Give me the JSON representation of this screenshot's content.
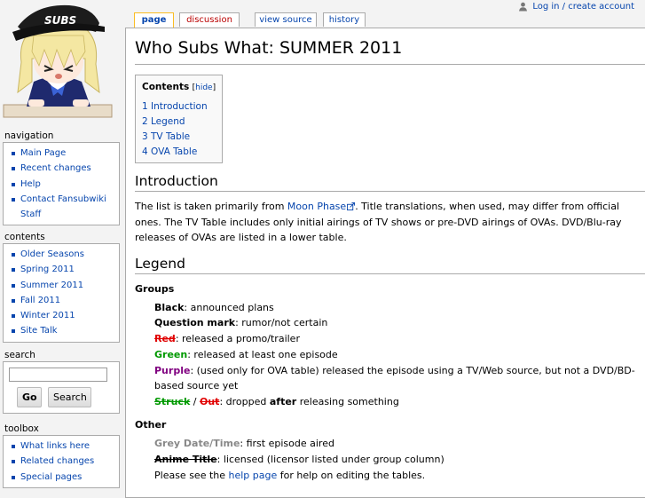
{
  "personal": {
    "login_label": "Log in / create account"
  },
  "tabs": [
    {
      "label": "page",
      "selected": true
    },
    {
      "label": "discussion",
      "new": true
    },
    {
      "label": "view source"
    },
    {
      "label": "history"
    }
  ],
  "logo": {
    "cap_text": "SUBS"
  },
  "page": {
    "title": "Who Subs What: SUMMER 2011",
    "toc": {
      "title": "Contents",
      "toggle": "hide",
      "items": [
        "1 Introduction",
        "2 Legend",
        "3 TV Table",
        "4 OVA Table"
      ]
    },
    "intro": {
      "heading": "Introduction",
      "before_link": "The list is taken primarily from ",
      "link": "Moon Phase",
      "after_link": ". Title translations, when used, may differ from official ones. The TV Table includes only initial airings of TV shows or pre-DVD airings of OVAs. DVD/Blu-ray releases of OVAs are listed in a lower table."
    },
    "legend": {
      "heading": "Legend",
      "groups_heading": "Groups",
      "black_term": "Black",
      "black_desc": ": announced plans",
      "question_term": "Question mark",
      "question_desc": ": rumor/not certain",
      "red_term": "Red",
      "red_desc": ": released a promo/trailer",
      "green_term": "Green",
      "green_desc": ": released at least one episode",
      "purple_term": "Purple",
      "purple_desc": ": (used only for OVA table) released the episode using a TV/Web source, but not a DVD/BD-based source yet",
      "struck_term": "Struck",
      "slash": " / ",
      "out_term": "Out",
      "dropped_pre": ": dropped ",
      "dropped_bold": "after",
      "dropped_post": " releasing something",
      "other_heading": "Other",
      "grey_term": "Grey Date/Time",
      "grey_desc": ": first episode aired",
      "anime_term": "Anime Title",
      "anime_desc": ": licensed (licensor listed under group column)",
      "help_pre": "Please see the ",
      "help_link": "help page",
      "help_post": " for help on editing the tables."
    }
  },
  "sidebar": {
    "navigation": {
      "title": "navigation",
      "items": [
        "Main Page",
        "Recent changes",
        "Help",
        "Contact Fansubwiki Staff"
      ]
    },
    "contents": {
      "title": "contents",
      "items": [
        "Older Seasons",
        "Spring 2011",
        "Summer 2011",
        "Fall 2011",
        "Winter 2011",
        "Site Talk"
      ]
    },
    "search": {
      "title": "search",
      "go_label": "Go",
      "search_label": "Search"
    },
    "toolbox": {
      "title": "toolbox",
      "items": [
        "What links here",
        "Related changes",
        "Special pages"
      ]
    }
  },
  "colors": {
    "link": "#0645ad",
    "red": "#e00000",
    "green": "#009900",
    "purple": "#800080",
    "grey": "#888888",
    "tab_selected_border": "#fabd23",
    "new_tab": "#ba0000"
  }
}
